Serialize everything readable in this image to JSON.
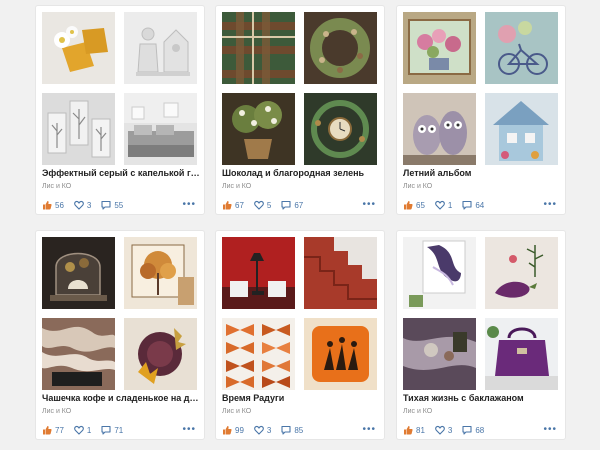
{
  "cards": [
    {
      "title": "Эффектный серый с капелькой горчицы",
      "author": "Лис и КО",
      "likes": "56",
      "hearts": "3",
      "comments": "55"
    },
    {
      "title": "Шоколад и благородная зелень",
      "author": "Лис и КО",
      "likes": "67",
      "hearts": "5",
      "comments": "67"
    },
    {
      "title": "Летний альбом",
      "author": "Лис и КО",
      "likes": "65",
      "hearts": "1",
      "comments": "64"
    },
    {
      "title": "Чашечка кофе и сладенькое на десерт",
      "author": "Лис и КО",
      "likes": "77",
      "hearts": "1",
      "comments": "71"
    },
    {
      "title": "Время Радуги",
      "author": "Лис и КО",
      "likes": "99",
      "hearts": "3",
      "comments": "85"
    },
    {
      "title": "Тихая жизнь с баклажаном",
      "author": "Лис и КО",
      "likes": "81",
      "hearts": "3",
      "comments": "68"
    }
  ],
  "icons": {
    "like": "thumbs-up-icon",
    "heart": "heart-icon",
    "comment": "comment-icon",
    "more": "more-dots-icon"
  },
  "colors": {
    "like_orange": "#e07b32",
    "accent_blue": "#4a76a8"
  },
  "more_label": "•••"
}
